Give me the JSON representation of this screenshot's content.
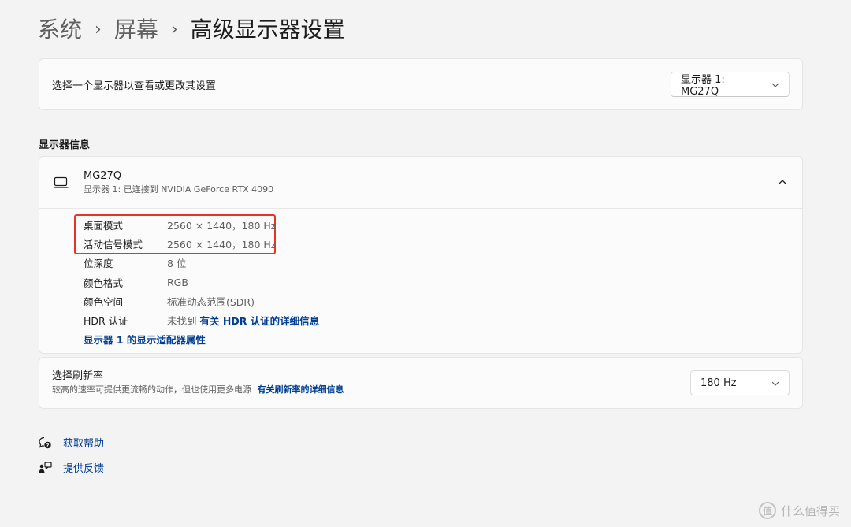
{
  "breadcrumb": {
    "items": [
      "系统",
      "屏幕",
      "高级显示器设置"
    ],
    "separator": "›"
  },
  "display_select": {
    "label": "选择一个显示器以查看或更改其设置",
    "value": "显示器 1: MG27Q"
  },
  "section": {
    "title": "显示器信息"
  },
  "monitor": {
    "name": "MG27Q",
    "subtitle": "显示器 1: 已连接到 NVIDIA GeForce RTX 4090",
    "rows": [
      {
        "key": "桌面模式",
        "value": "2560 × 1440，180 Hz"
      },
      {
        "key": "活动信号模式",
        "value": "2560 × 1440，180 Hz"
      },
      {
        "key": "位深度",
        "value": "8 位"
      },
      {
        "key": "颜色格式",
        "value": "RGB"
      },
      {
        "key": "颜色空间",
        "value": "标准动态范围(SDR)"
      },
      {
        "key": "HDR 认证",
        "value": "未找到",
        "link": "有关 HDR 认证的详细信息"
      }
    ],
    "adapter_link": "显示器 1 的显示适配器属性"
  },
  "refresh": {
    "label": "选择刷新率",
    "desc": "较高的速率可提供更流畅的动作，但也使用更多电源",
    "link": "有关刷新率的详细信息",
    "value": "180 Hz"
  },
  "help": {
    "get_help": "获取帮助",
    "feedback": "提供反馈"
  },
  "watermark": {
    "badge": "值",
    "text": "什么值得买"
  },
  "colors": {
    "accent_link": "#003e92",
    "highlight": "#e8332a",
    "background": "#f3f3f3"
  },
  "icons": {
    "monitor": "monitor-icon",
    "collapse": "chevron-up-icon",
    "dropdown": "chevron-down-icon",
    "help": "help-icon",
    "feedback": "feedback-icon"
  }
}
